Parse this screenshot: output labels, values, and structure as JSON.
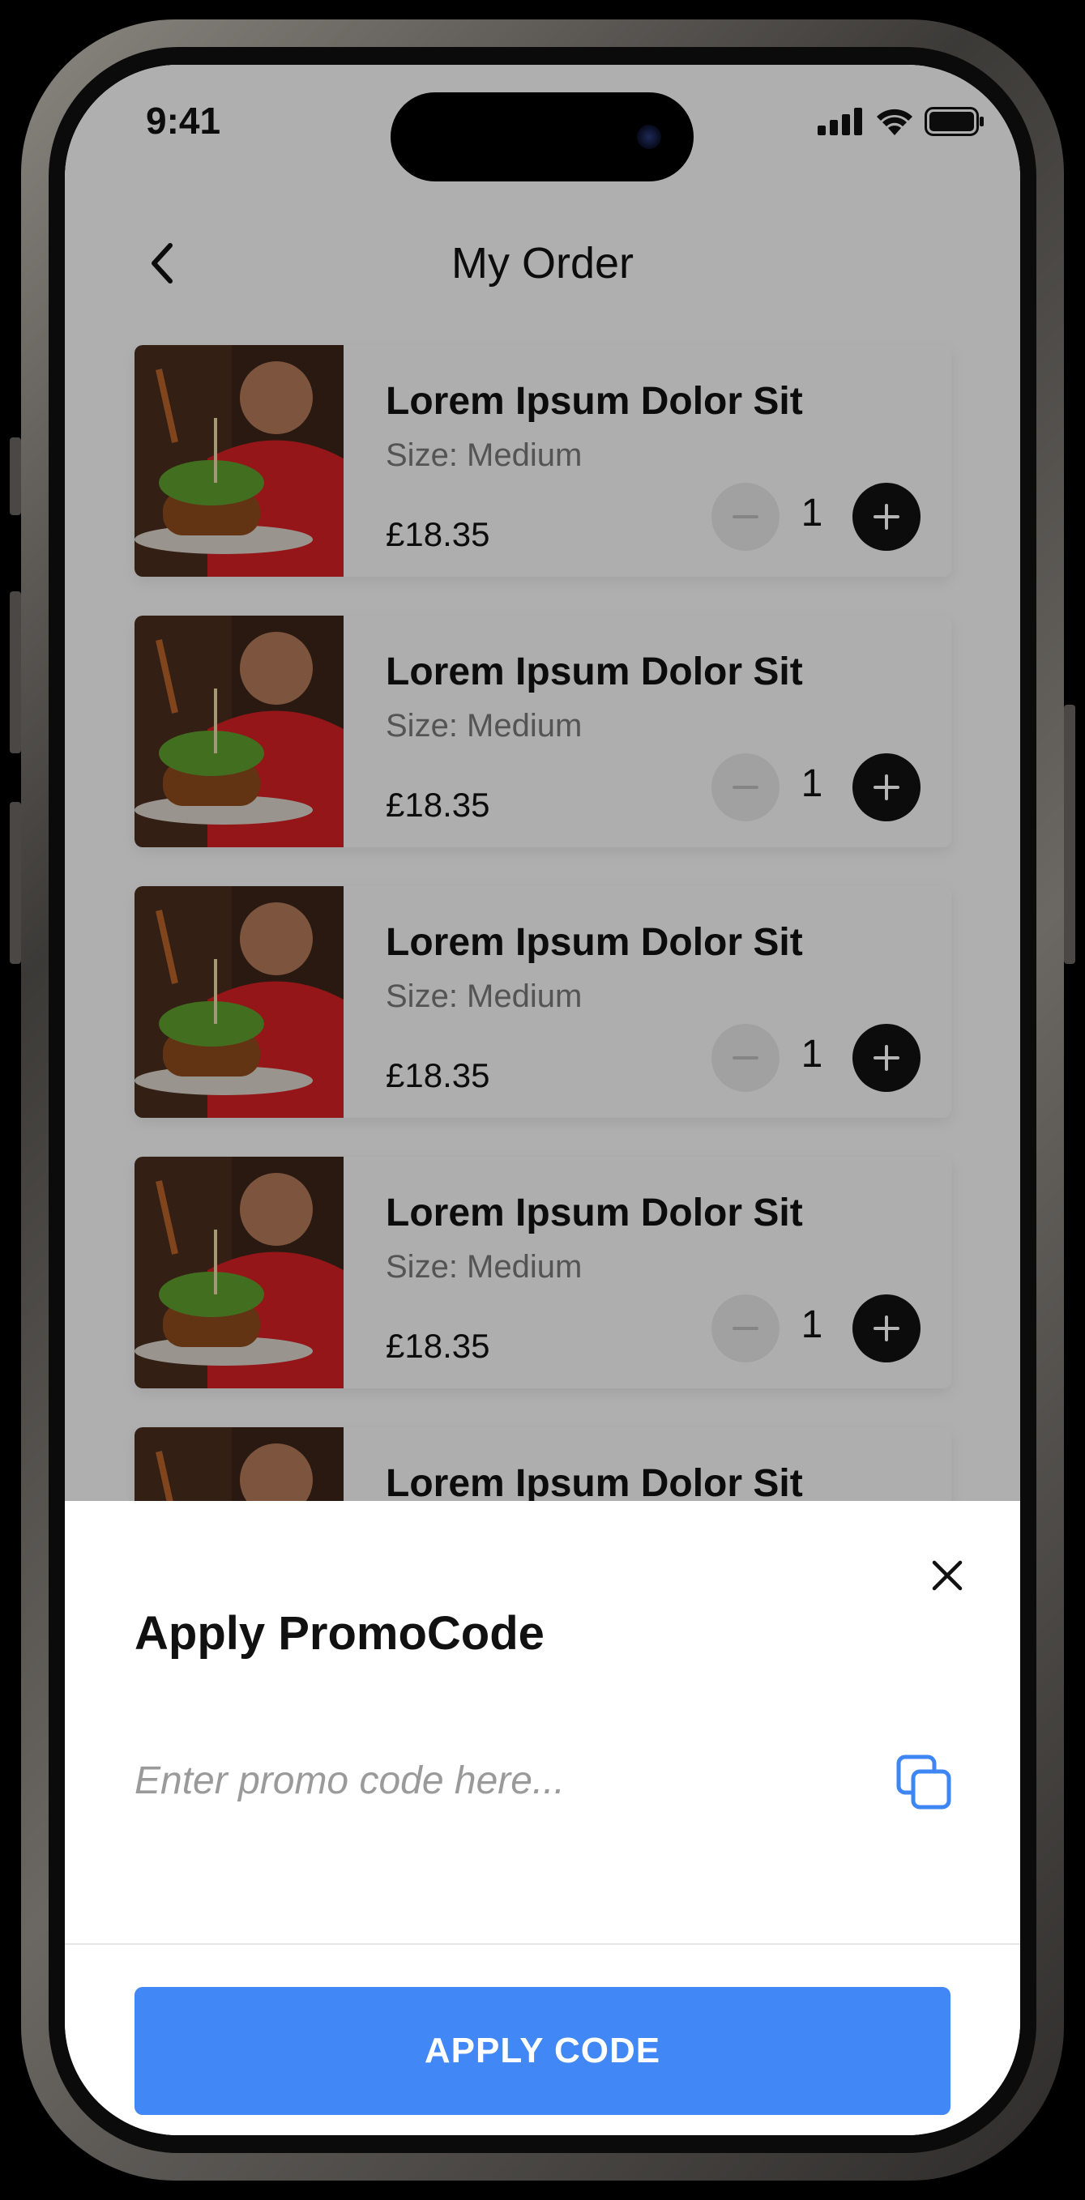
{
  "status_bar": {
    "time": "9:41"
  },
  "header": {
    "title": "My Order"
  },
  "order_items": [
    {
      "name": "Lorem Ipsum Dolor Sit",
      "size": "Size: Medium",
      "price": "£18.35",
      "quantity": "1"
    },
    {
      "name": "Lorem Ipsum Dolor Sit",
      "size": "Size: Medium",
      "price": "£18.35",
      "quantity": "1"
    },
    {
      "name": "Lorem Ipsum Dolor Sit",
      "size": "Size: Medium",
      "price": "£18.35",
      "quantity": "1"
    },
    {
      "name": "Lorem Ipsum Dolor Sit",
      "size": "Size: Medium",
      "price": "£18.35",
      "quantity": "1"
    },
    {
      "name": "Lorem Ipsum Dolor Sit",
      "size": "",
      "price": "",
      "quantity": ""
    }
  ],
  "promo_sheet": {
    "title": "Apply PromoCode",
    "input_placeholder": "Enter promo code here...",
    "apply_label": "APPLY CODE"
  },
  "colors": {
    "accent": "#4187f5",
    "overlay": "rgba(0,0,0,0.29)",
    "dark": "#111111"
  },
  "icons": {
    "back": "chevron-left-icon",
    "minus": "minus-icon",
    "plus": "plus-icon",
    "close": "close-icon",
    "copy": "copy-icon",
    "signal": "signal-icon",
    "wifi": "wifi-icon",
    "battery": "battery-icon"
  }
}
